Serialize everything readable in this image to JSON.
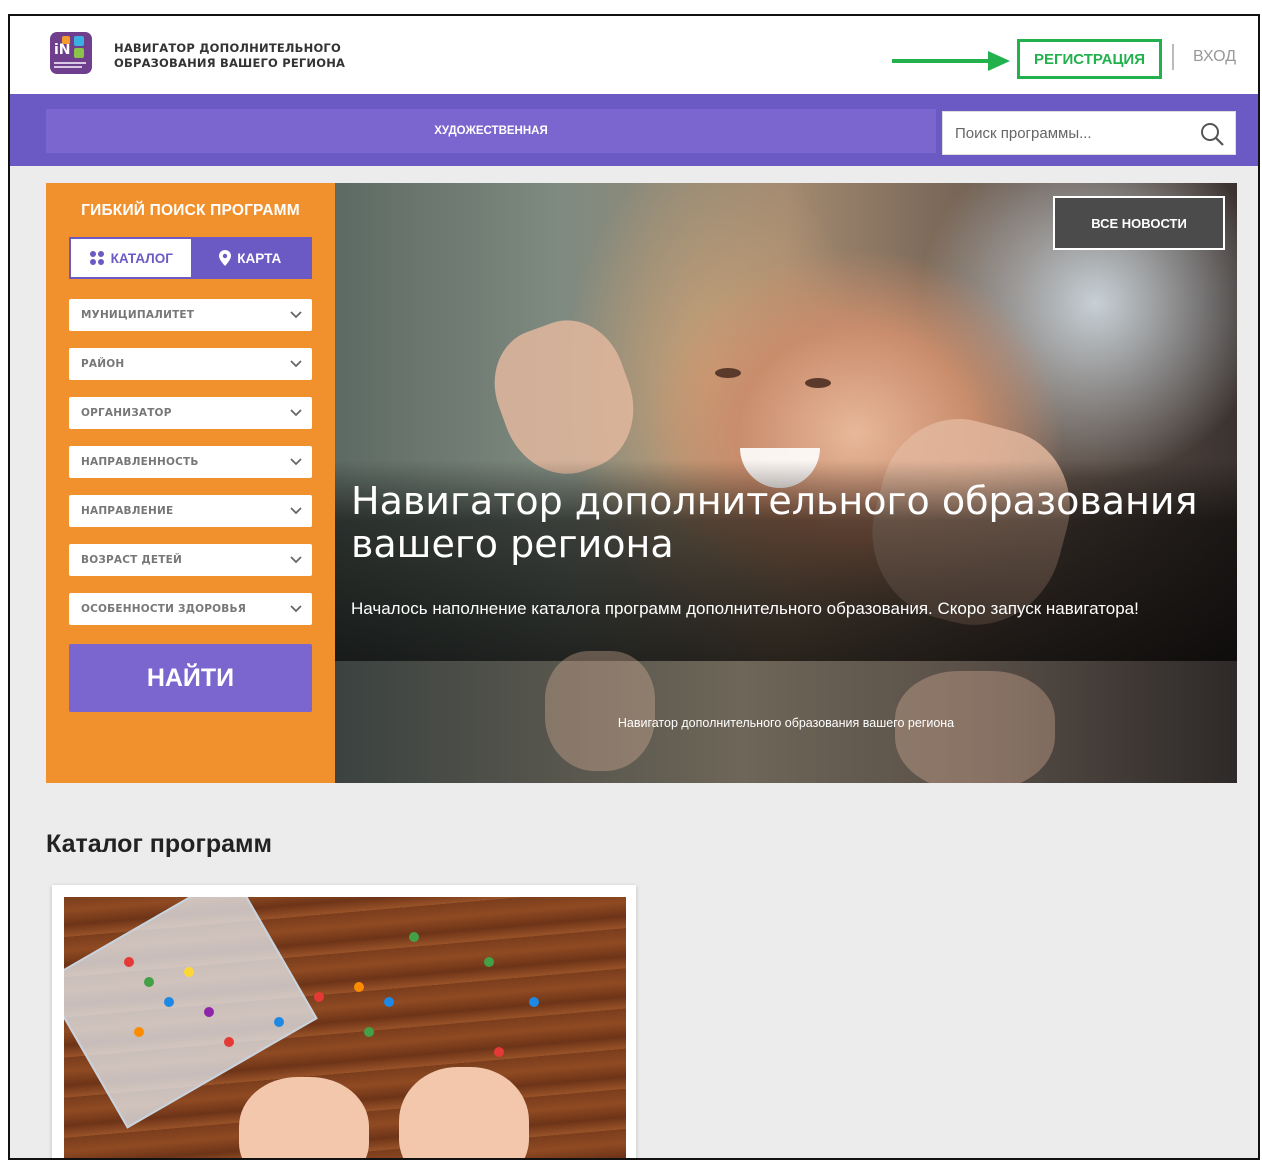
{
  "header": {
    "brand_line1": "НАВИГАТОР ДОПОЛНИТЕЛЬНОГО",
    "brand_line2": "ОБРАЗОВАНИЯ ВАШЕГО РЕГИОНА",
    "register_label": "РЕГИСТРАЦИЯ",
    "login_label": "ВХОД",
    "highlight_color": "#22b14c"
  },
  "nav": {
    "category_label": "ХУДОЖЕСТВЕННАЯ",
    "search_placeholder": "Поиск программы..."
  },
  "search_panel": {
    "title": "ГИБКИЙ ПОИСК ПРОГРАММ",
    "tabs": [
      {
        "label": "КАТАЛОГ",
        "icon": "grid-icon",
        "active": true
      },
      {
        "label": "КАРТА",
        "icon": "map-pin-icon",
        "active": false
      }
    ],
    "filters": [
      "МУНИЦИПАЛИТЕТ",
      "РАЙОН",
      "ОРГАНИЗАТОР",
      "НАПРАВЛЕННОСТЬ",
      "НАПРАВЛЕНИЕ",
      "ВОЗРАСТ ДЕТЕЙ",
      "ОСОБЕННОСТИ ЗДОРОВЬЯ"
    ],
    "find_label": "НАЙТИ"
  },
  "hero": {
    "news_button": "ВСЕ НОВОСТИ",
    "title": "Навигатор дополнительного образования вашего региона",
    "subtitle": "Началось наполнение каталога программ дополнительного образования. Скоро запуск навигатора!",
    "slide_caption": "Навигатор дополнительного образования вашего региона"
  },
  "catalog": {
    "title": "Каталог программ"
  },
  "colors": {
    "purple": "#6c5ac4",
    "orange": "#f1912d"
  }
}
